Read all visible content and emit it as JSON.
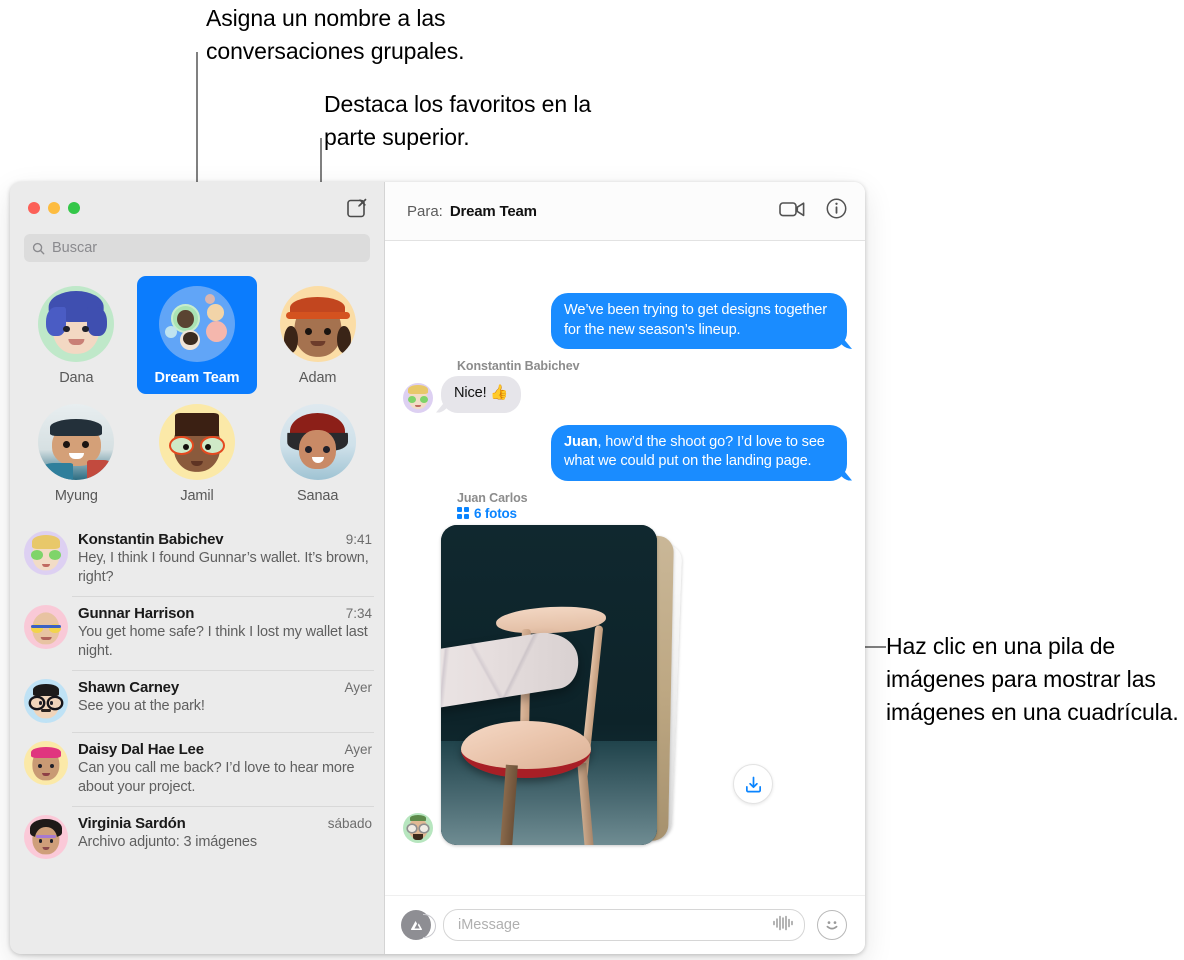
{
  "callouts": [
    {
      "id": "name-group-conversations",
      "text": "Asigna un nombre a las conversaciones grupales."
    },
    {
      "id": "highlight-favorites",
      "text": "Destaca los favoritos en la parte superior."
    },
    {
      "id": "click-image-stack",
      "text": "Haz clic en una pila de imágenes para mostrar las imágenes en una cuadrícula."
    }
  ],
  "window": {
    "traffic_lights": {
      "close": "close-button",
      "minimize": "minimize-button",
      "zoom": "zoom-button"
    },
    "compose_label": "compose-icon"
  },
  "sidebar": {
    "search": {
      "placeholder": "Buscar",
      "icon": "search-icon"
    },
    "favorites": [
      {
        "name": "Dana",
        "selected": false,
        "avatar_bg": "#bfe8c9",
        "kind": "memoji"
      },
      {
        "name": "Dream Team",
        "selected": true,
        "avatar_bg": "#61a5f7",
        "kind": "group"
      },
      {
        "name": "Adam",
        "selected": false,
        "avatar_bg": "#fbdda6",
        "kind": "memoji"
      },
      {
        "name": "Myung",
        "selected": false,
        "avatar_bg": "#f0f0ee",
        "kind": "photo"
      },
      {
        "name": "Jamil",
        "selected": false,
        "avatar_bg": "#fbe9a8",
        "kind": "memoji"
      },
      {
        "name": "Sanaa",
        "selected": false,
        "avatar_bg": "#dfe8ee",
        "kind": "photo"
      }
    ],
    "conversations": [
      {
        "name": "Konstantin Babichev",
        "time": "9:41",
        "preview": "Hey, I think I found Gunnar’s wallet. It’s brown, right?",
        "avatar_bg": "#ddd0f2"
      },
      {
        "name": "Gunnar Harrison",
        "time": "7:34",
        "preview": "You get home safe? I think I lost my wallet last night.",
        "avatar_bg": "#f9c9d7"
      },
      {
        "name": "Shawn Carney",
        "time": "Ayer",
        "preview": "See you at the park!",
        "avatar_bg": "#bfe2f5"
      },
      {
        "name": "Daisy Dal Hae Lee",
        "time": "Ayer",
        "preview": "Can you call me back? I’d love to hear more about your project.",
        "avatar_bg": "#fbe9a8"
      },
      {
        "name": "Virginia Sardón",
        "time": "sábado",
        "preview": "Archivo adjunto:  3 imágenes",
        "avatar_bg": "#fbc9d8"
      }
    ]
  },
  "chat": {
    "header": {
      "to_label": "Para:",
      "to_value": "Dream Team",
      "facetime_icon": "video-camera-icon",
      "info_icon": "info-circle-icon"
    },
    "messages": [
      {
        "direction": "out",
        "text": "We’ve been trying to get designs together for the new season’s lineup."
      },
      {
        "direction": "in",
        "sender": "Konstantin Babichev",
        "text": "Nice! 👍"
      },
      {
        "direction": "out",
        "bold_prefix": "Juan",
        "text": ", how’d the shoot go? I’d love to see what we could put on the landing page."
      }
    ],
    "attachment": {
      "sender": "Juan Carlos",
      "count_label": "6 fotos",
      "grid_icon": "photo-grid-icon",
      "save_icon": "save-download-icon"
    },
    "composer": {
      "apps_icon": "app-store-icon",
      "placeholder": "iMessage",
      "audio_icon": "audio-waveform-icon",
      "emoji_icon": "emoji-smiley-icon"
    }
  },
  "colors": {
    "accent_blue": "#1a8cff",
    "selected_blue": "#0b7cfd",
    "link_blue": "#0a84ff",
    "bubble_gray": "#e6e5ea",
    "sidebar_bg": "#ebebeb"
  }
}
